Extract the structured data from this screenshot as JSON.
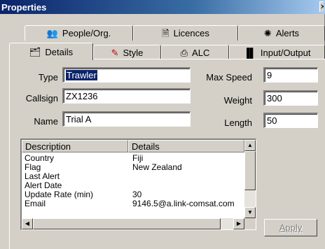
{
  "window": {
    "title": "Properties",
    "close_glyph": "✕"
  },
  "tabs_row1": [
    {
      "label": "People/Org.",
      "icon": "people-icon"
    },
    {
      "label": "Licences",
      "icon": "licence-icon"
    },
    {
      "label": "Alerts",
      "icon": "alert-icon"
    }
  ],
  "tabs_row2": [
    {
      "label": "Details",
      "icon": "details-icon",
      "active": true
    },
    {
      "label": "Style",
      "icon": "style-icon"
    },
    {
      "label": "ALC",
      "icon": "alc-icon"
    },
    {
      "label": "Input/Output",
      "icon": "input-output-icon"
    }
  ],
  "form": {
    "type_label": "Type",
    "type_value": "Trawler",
    "callsign_label": "Callsign",
    "callsign_value": "ZX1236",
    "name_label": "Name",
    "name_value": "Trial A",
    "max_speed_label": "Max Speed",
    "max_speed_value": "9",
    "weight_label": "Weight",
    "weight_value": "300",
    "length_label": "Length",
    "length_value": "50"
  },
  "grid": {
    "headers": [
      "Description",
      "Details"
    ],
    "rows": [
      [
        "Country",
        "Fiji"
      ],
      [
        "Flag",
        "New Zealand"
      ],
      [
        "Last Alert",
        ""
      ],
      [
        "Alert Date",
        ""
      ],
      [
        "Update Rate (min)",
        "30"
      ],
      [
        "Email",
        "9146.5@a.link-comsat.com"
      ]
    ]
  },
  "buttons": {
    "apply_label": "Apply",
    "apply_enabled": false
  }
}
